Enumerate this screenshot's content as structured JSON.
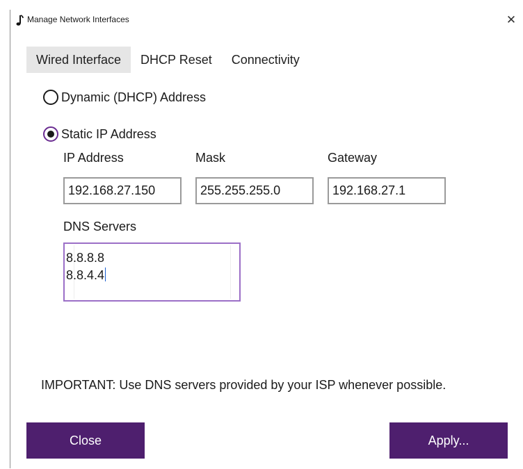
{
  "window": {
    "title": "Manage Network Interfaces",
    "close_glyph": "✕",
    "icon": "music-note-icon"
  },
  "tabs": [
    {
      "label": "Wired Interface",
      "active": true
    },
    {
      "label": "DHCP Reset",
      "active": false
    },
    {
      "label": "Connectivity",
      "active": false
    }
  ],
  "address_mode": {
    "dynamic_label": "Dynamic (DHCP) Address",
    "static_label": "Static IP Address",
    "selected": "static"
  },
  "fields": {
    "ip_label": "IP Address",
    "ip_value": "192.168.27.150",
    "mask_label": "Mask",
    "mask_value": "255.255.255.0",
    "gateway_label": "Gateway",
    "gateway_value": "192.168.27.1",
    "dns_label": "DNS Servers",
    "dns_lines": [
      "8.8.8.8",
      "8.8.4.4"
    ]
  },
  "notice": "IMPORTANT: Use DNS servers provided by your ISP whenever possible.",
  "buttons": {
    "close_label": "Close",
    "apply_label": "Apply..."
  },
  "colors": {
    "accent": "#4e1f6e",
    "focus_border": "#9b6fc7",
    "active_tab_bg": "#e6e6e6"
  }
}
